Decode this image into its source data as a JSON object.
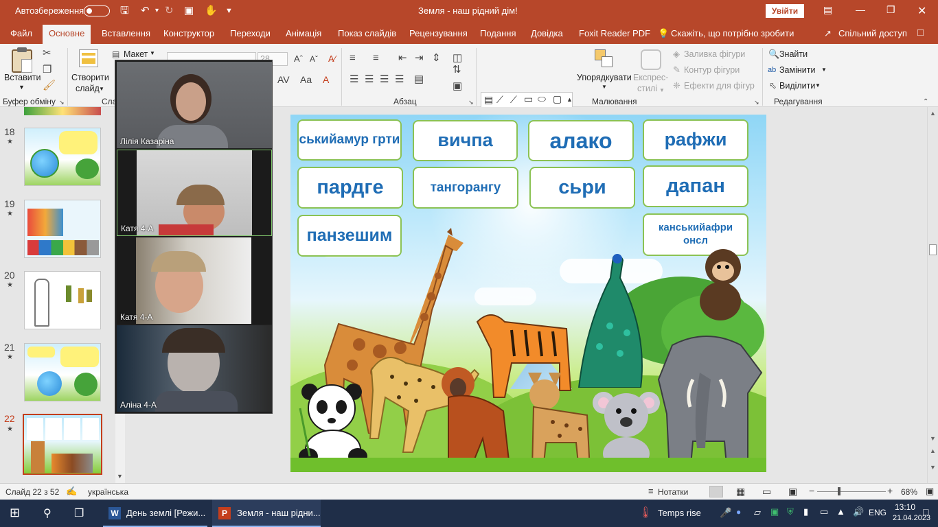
{
  "titlebar": {
    "autosave_label": "Автозбереження",
    "doc_title": "Земля - наш рідний дім!",
    "signin_label": "Увійти",
    "accent": "#b7472a"
  },
  "tabs": [
    {
      "label": "Файл"
    },
    {
      "label": "Основне"
    },
    {
      "label": "Вставлення"
    },
    {
      "label": "Конструктор"
    },
    {
      "label": "Переходи"
    },
    {
      "label": "Анімація"
    },
    {
      "label": "Показ слайдів"
    },
    {
      "label": "Рецензування"
    },
    {
      "label": "Подання"
    },
    {
      "label": "Довідка"
    },
    {
      "label": "Foxit Reader PDF"
    },
    {
      "label": "Скажіть, що потрібно зробити"
    },
    {
      "label": "Спільний доступ"
    }
  ],
  "ribbon": {
    "paste": "Вставити",
    "new_slide_1": "Створити",
    "new_slide_2": "слайд",
    "layout": "Макет",
    "group_clipboard": "Буфер обміну",
    "group_slides": "Сла",
    "group_paragraph": "Абзац",
    "font_size": "28",
    "arrange": "Упорядкувати",
    "express_1": "Експрес-",
    "express_2": "стилі",
    "fill": "Заливка фігури",
    "outline": "Контур фігури",
    "effects": "Ефекти для фігур",
    "group_drawing": "Малювання",
    "find": "Знайти",
    "replace": "Замінити",
    "select": "Виділити",
    "group_editing": "Редагування"
  },
  "thumbnails": [
    {
      "num": "18",
      "star": "★"
    },
    {
      "num": "19",
      "star": "★"
    },
    {
      "num": "20",
      "star": "★"
    },
    {
      "num": "21",
      "star": "★"
    },
    {
      "num": "22",
      "star": "★"
    }
  ],
  "slide": {
    "cards": [
      {
        "text": "ськийамур грти"
      },
      {
        "text": "вичпа"
      },
      {
        "text": "алако"
      },
      {
        "text": "рафжи"
      },
      {
        "text": "пардге"
      },
      {
        "text": "тангорангу"
      },
      {
        "text": "сьри"
      },
      {
        "text": "дапан"
      },
      {
        "text": "панзешим"
      },
      {
        "text": "канськийафри онсл"
      }
    ]
  },
  "video": {
    "participants": [
      {
        "name": "Лілія Казаріна"
      },
      {
        "name": "Катя  4-А"
      },
      {
        "name": "Катя 4-А"
      },
      {
        "name": "Аліна 4-А"
      }
    ]
  },
  "statusbar": {
    "slide_count": "Слайд 22 з 52",
    "language": "українська",
    "notes": "Нотатки",
    "zoom": "68%",
    "zoom_level": 0.68
  },
  "taskbar": {
    "app1": "День землі [Режи...",
    "app2": "Земля - наш рідни...",
    "weather": "Temps rise",
    "lang": "ENG",
    "time": "13:10",
    "date": "21.04.2023"
  }
}
